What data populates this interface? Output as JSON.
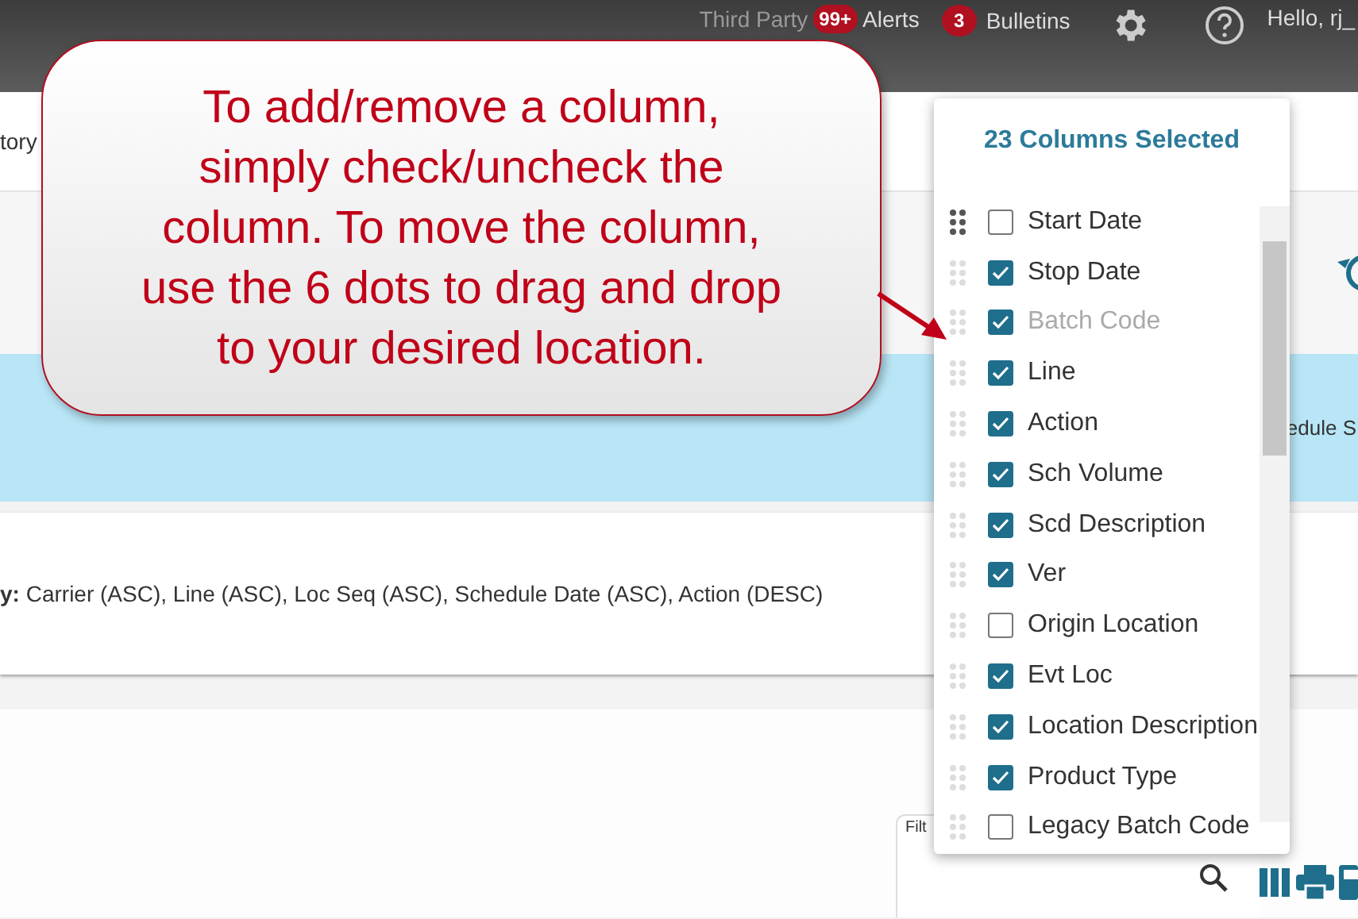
{
  "top_bar": {
    "third_party": "Third Party",
    "alerts_badge": "99+",
    "alerts": "Alerts",
    "bulletins_badge": "3",
    "bulletins": "Bulletins",
    "greeting": "Hello, rj_"
  },
  "header": {
    "title_fragment": "tory"
  },
  "blue_band": {
    "text_fragment": "edule S"
  },
  "sort_card": {
    "text": "**y:** Carrier (ASC), Line (ASC), Loc Seq (ASC), Schedule Date (ASC), Action (DESC)"
  },
  "filter": {
    "label": "Filt"
  },
  "column_chooser": {
    "title": "23 Columns Selected",
    "columns": [
      {
        "label": "Start Date",
        "checked": false,
        "disabled": false,
        "hovered": true
      },
      {
        "label": "Stop Date",
        "checked": true,
        "disabled": false,
        "hovered": false
      },
      {
        "label": "Batch Code",
        "checked": true,
        "disabled": true,
        "hovered": false
      },
      {
        "label": "Line",
        "checked": true,
        "disabled": false,
        "hovered": false
      },
      {
        "label": "Action",
        "checked": true,
        "disabled": false,
        "hovered": false
      },
      {
        "label": "Sch Volume",
        "checked": true,
        "disabled": false,
        "hovered": false
      },
      {
        "label": "Scd Description",
        "checked": true,
        "disabled": false,
        "hovered": false
      },
      {
        "label": "Ver",
        "checked": true,
        "disabled": false,
        "hovered": false
      },
      {
        "label": "Origin Location",
        "checked": false,
        "disabled": false,
        "hovered": false
      },
      {
        "label": "Evt Loc",
        "checked": true,
        "disabled": false,
        "hovered": false
      },
      {
        "label": "Location Description",
        "checked": true,
        "disabled": false,
        "hovered": false
      },
      {
        "label": "Product Type",
        "checked": true,
        "disabled": false,
        "hovered": false
      },
      {
        "label": "Legacy Batch Code",
        "checked": false,
        "disabled": false,
        "hovered": false
      }
    ]
  },
  "callout": {
    "lines": [
      "To add/remove a column,",
      "simply check/uncheck the",
      "column. To move the column,",
      "use the 6 dots to drag and drop",
      "to your desired location."
    ]
  }
}
